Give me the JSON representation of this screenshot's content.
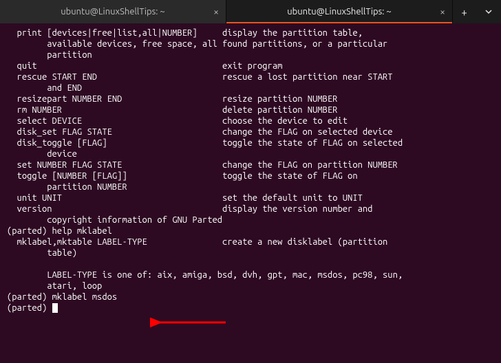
{
  "tabs": [
    {
      "title": "ubuntu@LinuxShellTips: ~",
      "active": false
    },
    {
      "title": "ubuntu@LinuxShellTips: ~",
      "active": true
    }
  ],
  "terminal_lines": [
    "  print [devices|free|list,all|NUMBER]     display the partition table,",
    "        available devices, free space, all found partitions, or a particular",
    "        partition",
    "  quit                                     exit program",
    "  rescue START END                         rescue a lost partition near START",
    "        and END",
    "  resizepart NUMBER END                    resize partition NUMBER",
    "  rm NUMBER                                delete partition NUMBER",
    "  select DEVICE                            choose the device to edit",
    "  disk_set FLAG STATE                      change the FLAG on selected device",
    "  disk_toggle [FLAG]                       toggle the state of FLAG on selected",
    "        device",
    "  set NUMBER FLAG STATE                    change the FLAG on partition NUMBER",
    "  toggle [NUMBER [FLAG]]                   toggle the state of FLAG on",
    "        partition NUMBER",
    "  unit UNIT                                set the default unit to UNIT",
    "  version                                  display the version number and",
    "        copyright information of GNU Parted",
    "(parted) help mklabel",
    "  mklabel,mktable LABEL-TYPE               create a new disklabel (partition",
    "        table)",
    "",
    "\tLABEL-TYPE is one of: aix, amiga, bsd, dvh, gpt, mac, msdos, pc98, sun,",
    "        atari, loop",
    "(parted) mklabel msdos",
    "(parted) "
  ]
}
